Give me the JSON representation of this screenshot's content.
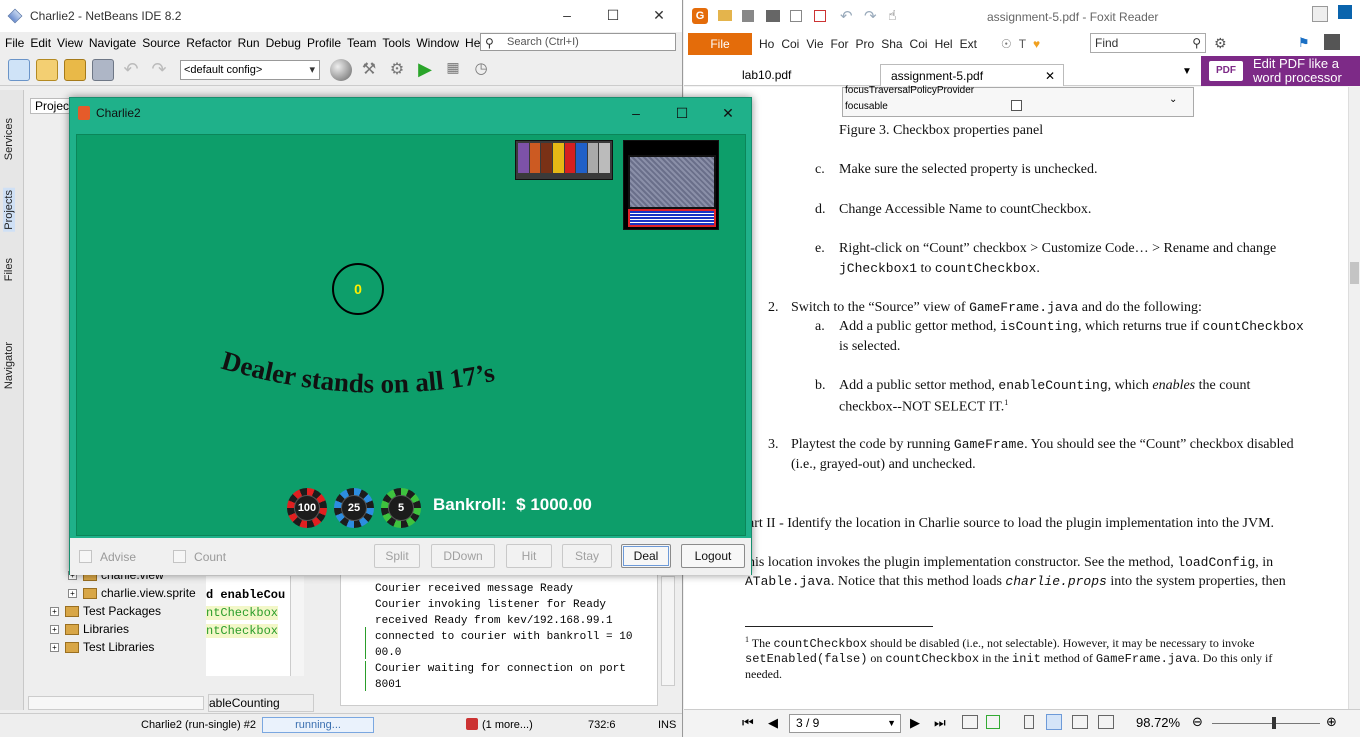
{
  "netbeans": {
    "title": "Charlie2 - NetBeans IDE 8.2",
    "menu": [
      "File",
      "Edit",
      "View",
      "Navigate",
      "Source",
      "Refactor",
      "Run",
      "Debug",
      "Profile",
      "Team",
      "Tools",
      "Window",
      "Help"
    ],
    "search_placeholder": "Search (Ctrl+I)",
    "config": "<default config>",
    "side_tabs": [
      "Services",
      "Projects",
      "Files",
      "Navigator"
    ],
    "projects_tab": "Projec",
    "tree": [
      "charlie.view",
      "charlie.view.sprite",
      "Test Packages",
      "Libraries",
      "Test Libraries"
    ],
    "code_fragments": [
      "d enableCou",
      "ntCheckbox",
      "ntCheckbox"
    ],
    "editor_tab": "ableCounting",
    "output_lines": [
      "Courier received message Ready",
      "Courier invoking listener for Ready",
      "received Ready from kev/192.168.99.1",
      "connected to courier with bankroll = 10",
      "00.0",
      "Courier waiting for connection on port",
      "8001"
    ],
    "status": {
      "task": "Charlie2 (run-single) #2",
      "progress": "running...",
      "more": "(1 more...)",
      "position": "732:6",
      "mode": "INS"
    }
  },
  "game": {
    "title": "Charlie2",
    "count_value": "0",
    "dealer_text": "Dealer stands on all 17’s",
    "chips": [
      "100",
      "25",
      "5"
    ],
    "bankroll_label": "Bankroll:",
    "bankroll_value": "$ 1000.00",
    "checkboxes": [
      "Advise",
      "Count"
    ],
    "buttons": [
      "Split",
      "DDown",
      "Hit",
      "Stay",
      "Deal",
      "Logout"
    ]
  },
  "foxit": {
    "title": "assignment-5.pdf - Foxit Reader",
    "file_tab": "File",
    "ribbon_tabs": [
      "Ho",
      "Coi",
      "Vie",
      "For",
      "Pro",
      "Sha",
      "Coi",
      "Hel",
      "Ext"
    ],
    "find_placeholder": "Find",
    "doc_tabs": [
      "lab10.pdf",
      "assignment-5.pdf"
    ],
    "promo": [
      "Edit PDF like a",
      "word processor"
    ],
    "table_rows": [
      "focusTraversalPolicyProvider",
      "focusable"
    ],
    "figure_caption": "Figure 3. Checkbox properties panel",
    "items": {
      "c": "Make sure the selected property is unchecked.",
      "d": "Change Accessible Name to countCheckbox.",
      "e1": "Right-click on “Count” checkbox > Customize Code… > Rename and change",
      "e2a": "jCheckbox1",
      "e2b": " to ",
      "e2c": "countCheckbox",
      "e2d": ".",
      "s2a": "Switch to the “Source” view of ",
      "s2b": "GameFrame.java",
      "s2c": " and do the following:",
      "a1a": "Add a public gettor method, ",
      "a1b": "isCounting",
      "a1c": ", which returns true if ",
      "a1d": "countCheckbox",
      "a2": "is selected.",
      "b1a": "Add a public settor method, ",
      "b1b": "enableCounting",
      "b1c": ", which ",
      "b1d": "enables",
      "b1e": " the count",
      "b2": "checkbox--NOT SELECT IT.",
      "b2sup": "1",
      "s3a": "Playtest the code by running ",
      "s3b": "GameFrame",
      "s3c": ". You should see the “Count” checkbox disabled",
      "s3d": "(i.e., grayed-out) and unchecked.",
      "part2": "art II - Identify the location in Charlie source to load the plugin implementation into the JVM.",
      "p1a": "his location invokes the plugin implementation constructor. See the method, ",
      "p1b": "loadConfig",
      "p1c": ", in",
      "p2a": "ATable.java",
      "p2b": ". Notice that this method loads ",
      "p2c": "charlie.props",
      "p2d": " into the system properties, then",
      "fn_sup": "1",
      "fn1a": " The ",
      "fn1b": "countCheckbox",
      "fn1c": " should be disabled (i.e., not selectable). However, it may be necessary to invoke",
      "fn2a": "setEnabled(false)",
      "fn2b": " on ",
      "fn2c": "countCheckbox",
      "fn2d": " in the ",
      "fn2e": "init",
      "fn2f": " method of ",
      "fn2g": "GameFrame.java",
      "fn2h": ". Do this only if",
      "fn3": "needed."
    },
    "labels": {
      "c": "c.",
      "d": "d.",
      "e": "e.",
      "n2": "2.",
      "a": "a.",
      "b": "b.",
      "n3": "3."
    },
    "page": "3 / 9",
    "zoom": "98.72%"
  },
  "colors": {
    "felt": "#0d9e6a",
    "frame": "#1fb18a",
    "foxit_orange": "#e46c0a",
    "promo": "#7d2a87"
  }
}
